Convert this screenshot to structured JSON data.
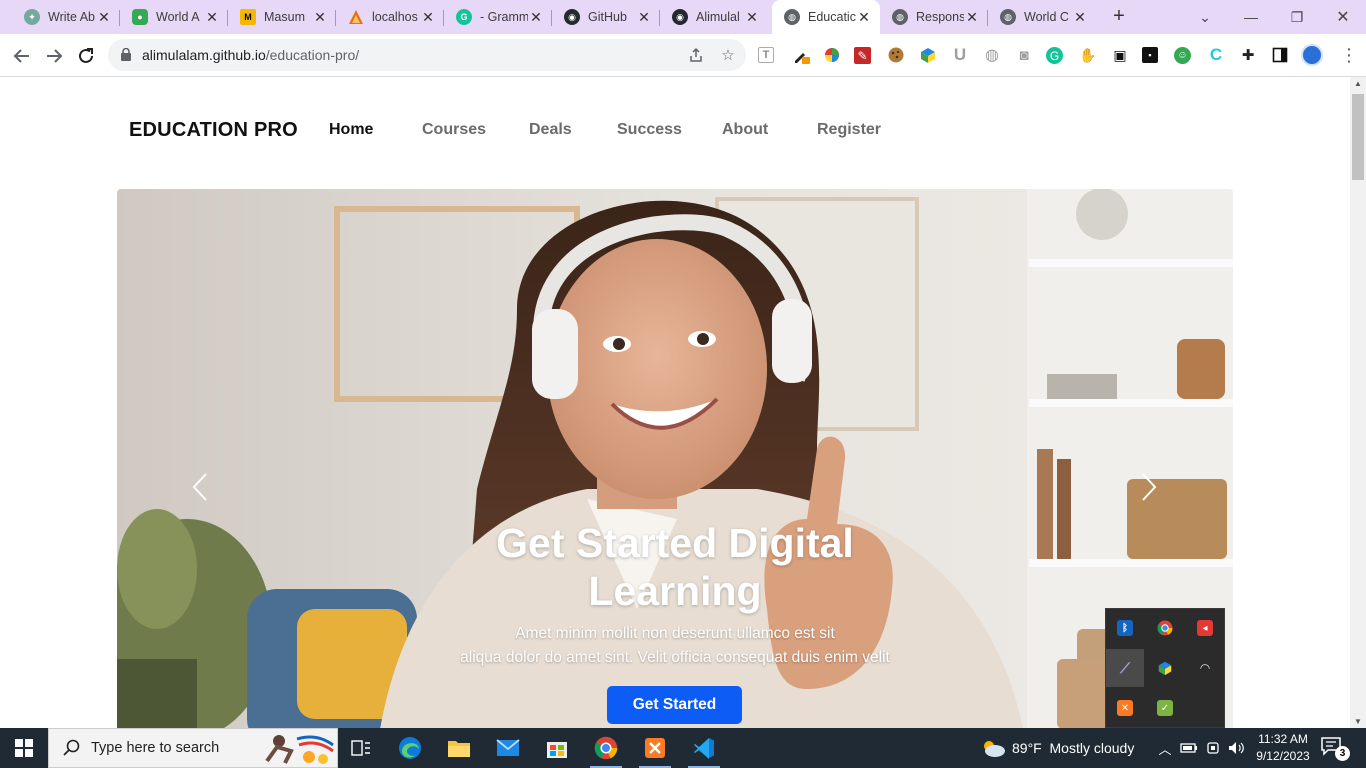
{
  "browser": {
    "tabs": [
      {
        "title": "Write Ab",
        "icon": "chatgpt-icon",
        "color": "#74aa9c"
      },
      {
        "title": "World A",
        "icon": "map-pin-icon",
        "color": "#34a853"
      },
      {
        "title": "Masum",
        "icon": "masum-site-icon",
        "color": "#f5b800"
      },
      {
        "title": "localhos",
        "icon": "localhost-icon",
        "color": "#e8710a"
      },
      {
        "title": "- Gramm",
        "icon": "grammarly-icon",
        "color": "#15c39a"
      },
      {
        "title": "GitHub",
        "icon": "github-icon",
        "color": "#24292f"
      },
      {
        "title": "Alimulal",
        "icon": "github-icon",
        "color": "#24292f"
      },
      {
        "title": "Educatic",
        "icon": "globe-icon",
        "color": "#5f6368",
        "active": true
      },
      {
        "title": "Respons",
        "icon": "globe-icon",
        "color": "#5f6368"
      },
      {
        "title": "World C",
        "icon": "globe-icon",
        "color": "#5f6368"
      }
    ],
    "url_host": "alimulalam.github.io",
    "url_path": "/education-pro/"
  },
  "site": {
    "brand": "EDUCATION PRO",
    "menu": [
      "Home",
      "Courses",
      "Deals",
      "Success",
      "About",
      "Register"
    ],
    "active_menu": "Home",
    "hero": {
      "title_line1": "Get Started Digital",
      "title_line2": "Learning",
      "sub_line1": "Amet minim mollit non deserunt ullamco est sit",
      "sub_line2": "aliqua dolor do amet sint. Velit officia consequat duis enim velit",
      "button": "Get Started",
      "button_color": "#0d5cf5"
    }
  },
  "taskbar": {
    "search_placeholder": "Type here to search",
    "weather_temp": "89°F",
    "weather_text": "Mostly cloudy",
    "time": "11:32 AM",
    "date": "9/12/2023",
    "notification_count": "3"
  }
}
